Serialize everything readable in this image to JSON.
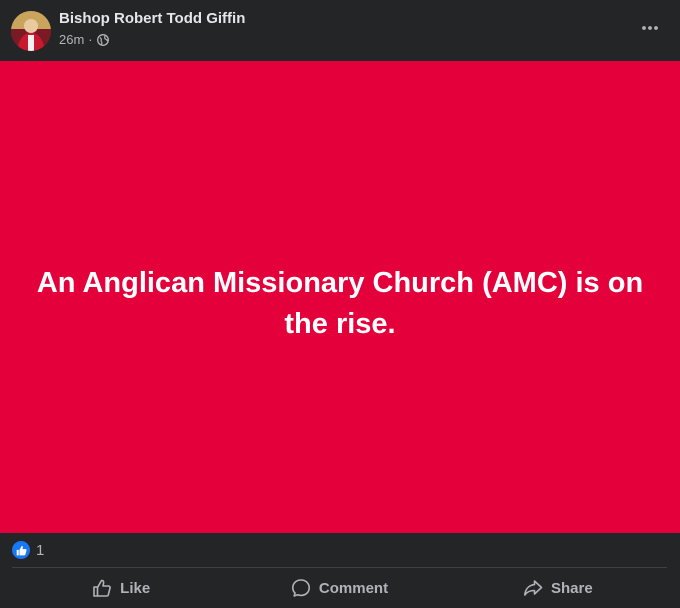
{
  "post": {
    "author": "Bishop Robert Todd Giffin",
    "time": "26m",
    "separator": "·",
    "audience_icon": "globe-icon",
    "menu_icon": "more-options-icon",
    "content_text": "An Anglican Missionary Church (AMC) is on the rise.",
    "background_color": "#e4003a"
  },
  "reactions": {
    "icon": "like-reaction-icon",
    "count": "1"
  },
  "actions": [
    {
      "label": "Like",
      "icon": "thumbs-up-icon"
    },
    {
      "label": "Comment",
      "icon": "comment-icon"
    },
    {
      "label": "Share",
      "icon": "share-icon"
    }
  ]
}
